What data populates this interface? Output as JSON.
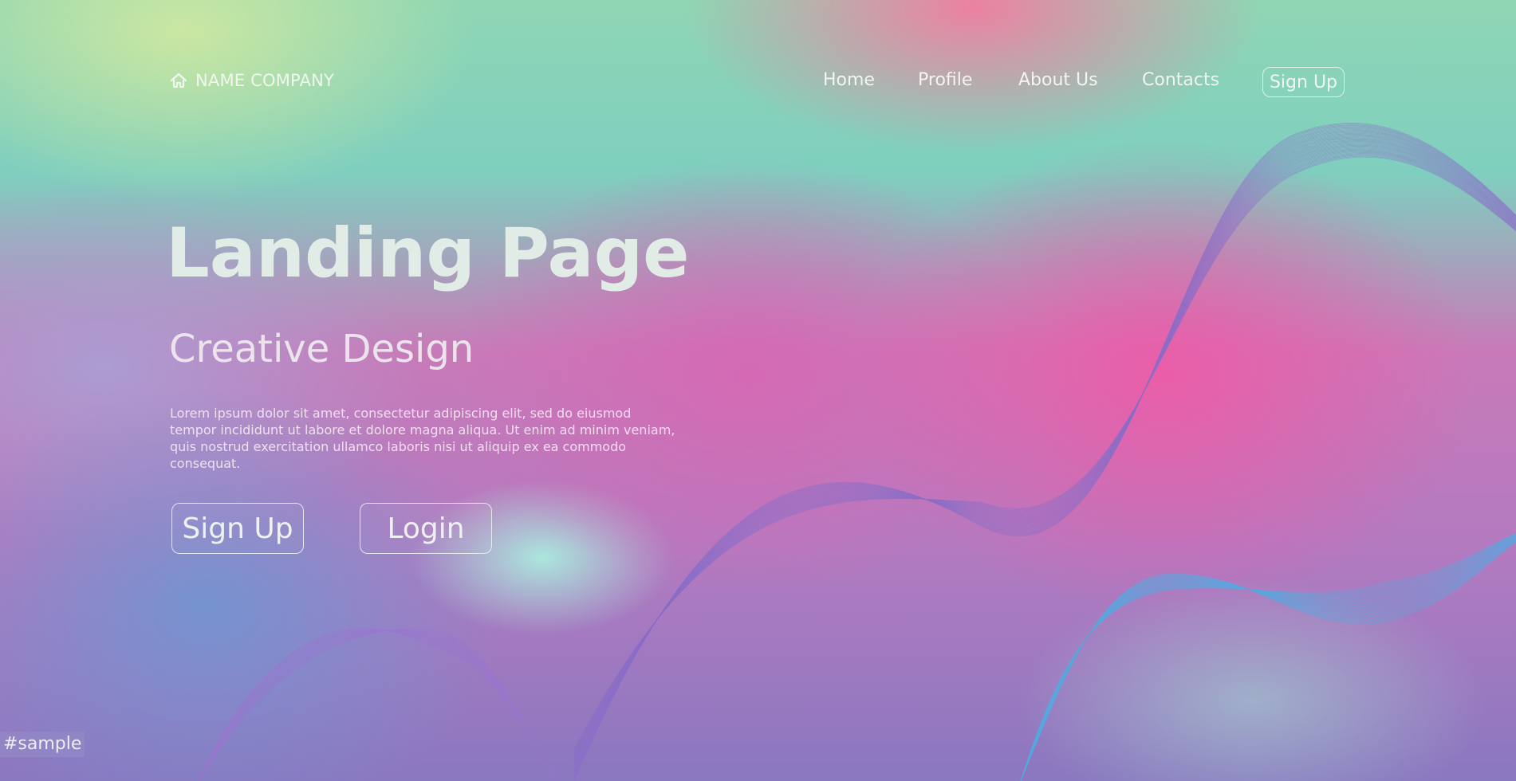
{
  "header": {
    "brand": "NAME COMPANY",
    "nav": [
      "Home",
      "Profile",
      "About Us",
      "Contacts"
    ],
    "signup": "Sign Up"
  },
  "hero": {
    "title": "Landing Page",
    "subtitle": "Creative Design",
    "body": "Lorem ipsum dolor sit amet, consectetur adipiscing elit, sed do eiusmod tempor incididunt ut labore et dolore magna aliqua. Ut enim ad minim veniam, quis nostrud exercitation ullamco laboris nisi ut aliquip ex ea commodo consequat.",
    "signup_button": "Sign Up",
    "login_button": "Login"
  },
  "watermark": "#sample",
  "icons": {
    "brand_icon": "home-icon"
  },
  "colors": {
    "text": "#eef4ef",
    "button_border": "#f0f6f0"
  }
}
